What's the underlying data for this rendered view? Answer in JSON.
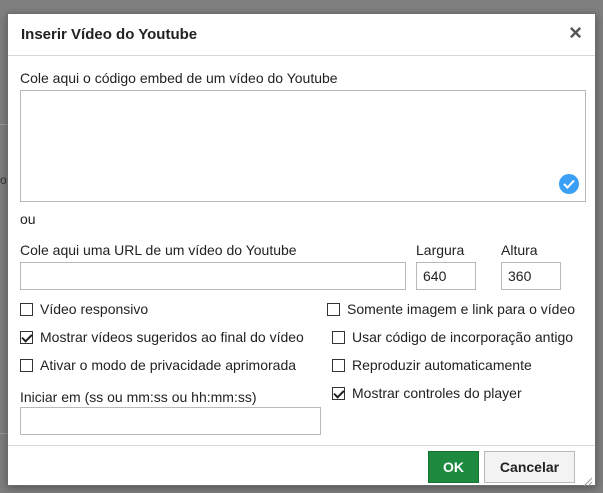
{
  "background": {
    "fragment_text": "or"
  },
  "dialog": {
    "title": "Inserir Vídeo do Youtube",
    "close_glyph": "×",
    "embed": {
      "label": "Cole aqui o código embed de um vídeo do Youtube",
      "value": ""
    },
    "separator": "ou",
    "url": {
      "label": "Cole aqui uma URL de um vídeo do Youtube",
      "value": ""
    },
    "width": {
      "label": "Largura",
      "value": "640"
    },
    "height": {
      "label": "Altura",
      "value": "360"
    },
    "options_left": [
      {
        "label": "Vídeo responsivo",
        "checked": false
      },
      {
        "label": "Mostrar vídeos sugeridos ao final do vídeo",
        "checked": true
      },
      {
        "label": "Ativar o modo de privacidade aprimorada",
        "checked": false
      }
    ],
    "options_right": [
      {
        "label": "Somente imagem e link para o vídeo",
        "checked": false
      },
      {
        "label": "Usar código de incorporação antigo",
        "checked": false
      },
      {
        "label": "Reproduzir automaticamente",
        "checked": false
      },
      {
        "label": "Mostrar controles do player",
        "checked": true
      }
    ],
    "start": {
      "label": "Iniciar em (ss ou mm:ss ou hh:mm:ss)",
      "value": ""
    },
    "buttons": {
      "ok": "OK",
      "cancel": "Cancelar"
    },
    "colors": {
      "ok_button": "#1d8a3f",
      "check_badge": "#3a9ff5"
    }
  }
}
